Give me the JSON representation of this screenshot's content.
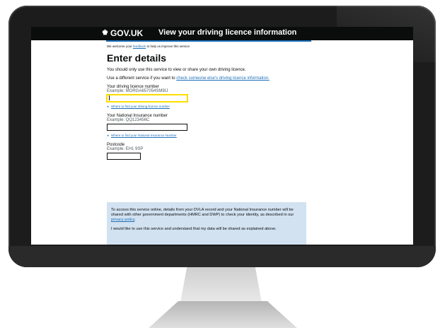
{
  "header": {
    "brand": "GOV.UK",
    "service_name": "View your driving licence information"
  },
  "beta_banner": {
    "prefix": "We welcome your ",
    "link": "feedback",
    "suffix": " to help us improve this service"
  },
  "page": {
    "title": "Enter details",
    "intro": "You should only use this service to view or share your own driving licence.",
    "other_service_prefix": "Use a different service if you want to ",
    "other_service_link": "check someone else's driving licence information."
  },
  "form": {
    "licence": {
      "label": "Your driving licence number",
      "hint": "Example: MORGA657054SM9IJ",
      "value": "",
      "help_link": "Where to find your driving licence number"
    },
    "ni": {
      "label": "Your National Insurance number",
      "hint": "Example: QQ123456C",
      "value": "",
      "help_link": "Where to find your National Insurance Number"
    },
    "postcode": {
      "label": "Postcode",
      "hint": "Example: EH1 9SP",
      "value": ""
    }
  },
  "consent_panel": {
    "text1_prefix": "To access this service online, details from your DVLA record and your National Insurance number will be shared with other government departments (HMRC and DWP) to check your identity, as described in our ",
    "privacy_link": "privacy policy",
    "text1_suffix": ".",
    "text2": "I would like to use this service and understand that my data will be shared as explained above."
  },
  "icons": {
    "crown": "crown-icon",
    "details_toggle": "triangle-right-icon"
  },
  "colors": {
    "header_bg": "#0b0c0c",
    "link": "#1d70b8",
    "focus": "#ffdd00",
    "panel_bg": "#d2e2f1"
  }
}
